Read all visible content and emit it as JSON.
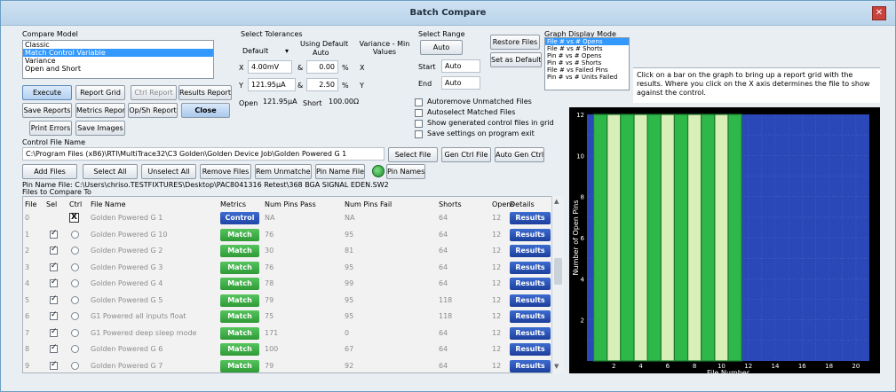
{
  "window": {
    "title": "Batch Compare"
  },
  "compare_model": {
    "label": "Compare Model",
    "options": [
      "Classic",
      "Match Control Variable",
      "Variance",
      "Open and Short"
    ],
    "selected": "Match Control Variable"
  },
  "tolerances": {
    "label": "Select Tolerances",
    "preset": "Default",
    "using_default": "Using Default",
    "auto": "Auto",
    "variance_min": "Variance - Min Values",
    "x_label": "X",
    "x_value": "4.00mV",
    "x_pct": "0.00",
    "x_unit": "X",
    "y_label": "Y",
    "y_value": "121.95µA",
    "y_pct": "2.50",
    "y_unit": "Y",
    "amp": "&",
    "pct_sign": "%",
    "open_label": "Open",
    "open_value": "121.95µA",
    "short_label": "Short",
    "short_value": "100.00Ω"
  },
  "range": {
    "label": "Select Range",
    "auto_button": "Auto",
    "start_label": "Start",
    "start_value": "Auto",
    "end_label": "End",
    "end_value": "Auto"
  },
  "buttons": {
    "execute": "Execute",
    "report_grid": "Report Grid",
    "ctrl_report": "Ctrl Report",
    "results_report": "Results Report",
    "save_reports": "Save Reports",
    "metrics_report": "Metrics Report",
    "op_sh_report": "Op/Sh Report",
    "close": "Close",
    "print_errors": "Print Errors",
    "save_images": "Save Images",
    "restore_files": "Restore Files",
    "set_as_default": "Set as Default",
    "select_file": "Select File",
    "gen_ctrl_file": "Gen Ctrl File",
    "auto_gen_ctrl": "Auto Gen Ctrl",
    "add_files": "Add Files",
    "select_all": "Select All",
    "unselect_all": "Unselect All",
    "remove_files": "Remove Files",
    "rem_unmatched": "Rem Unmatched",
    "pin_name_file": "Pin Name File",
    "pin_names": "Pin Names"
  },
  "options": [
    {
      "label": "Autoremove Unmatched Files",
      "checked": false
    },
    {
      "label": "Autoselect Matched Files",
      "checked": false
    },
    {
      "label": "Show generated control files in grid",
      "checked": false
    },
    {
      "label": "Save settings on program exit",
      "checked": false
    }
  ],
  "graph_mode": {
    "label": "Graph Display Mode",
    "options": [
      "File # vs # Opens",
      "File # vs # Shorts",
      "Pin # vs # Opens",
      "Pin # vs # Shorts",
      "File # vs Failed Pins",
      "Pin # vs # Units Failed"
    ],
    "selected": "File # vs # Opens"
  },
  "info_text": "Click on a bar on the graph to bring up a report grid with the results. Where you click on the X axis determines the file to show against the control.",
  "control_file": {
    "label": "Control File Name",
    "path": "C:\\Program Files (x86)\\RTI\\MultiTrace32\\C3 Golden\\Golden Device Job\\Golden Powered G 1"
  },
  "pin_name_file": "Pin Name File: C:\\Users\\chriso.TESTFIXTURES\\Desktop\\PAC8041316 Retest\\368 BGA SIGNAL EDEN.SW2",
  "files_label": "Files to Compare To",
  "table": {
    "headers": [
      "File",
      "Sel",
      "Ctrl",
      "File Name",
      "Metrics",
      "Num Pins Pass",
      "Num Pins Fail",
      "Shorts",
      "Opens",
      "Details"
    ],
    "rows": [
      {
        "file": "0",
        "sel": "X",
        "name": "Golden Powered G 1",
        "metrics": "Control",
        "pass": "NA",
        "fail": "NA",
        "shorts": "64",
        "opens": "12",
        "details": "Results"
      },
      {
        "file": "1",
        "sel": "check",
        "name": "Golden Powered G 10",
        "metrics": "Match",
        "pass": "76",
        "fail": "95",
        "shorts": "64",
        "opens": "12",
        "details": "Results"
      },
      {
        "file": "2",
        "sel": "check",
        "name": "Golden Powered G 2",
        "metrics": "Match",
        "pass": "30",
        "fail": "81",
        "shorts": "64",
        "opens": "12",
        "details": "Results"
      },
      {
        "file": "3",
        "sel": "check",
        "name": "Golden Powered G 3",
        "metrics": "Match",
        "pass": "76",
        "fail": "95",
        "shorts": "64",
        "opens": "12",
        "details": "Results"
      },
      {
        "file": "4",
        "sel": "check",
        "name": "Golden Powered G 4",
        "metrics": "Match",
        "pass": "78",
        "fail": "99",
        "shorts": "64",
        "opens": "12",
        "details": "Results"
      },
      {
        "file": "5",
        "sel": "check",
        "name": "Golden Powered G 5",
        "metrics": "Match",
        "pass": "79",
        "fail": "95",
        "shorts": "118",
        "opens": "12",
        "details": "Results"
      },
      {
        "file": "6",
        "sel": "check",
        "name": "G1 Powered all inputs float",
        "metrics": "Match",
        "pass": "75",
        "fail": "95",
        "shorts": "118",
        "opens": "12",
        "details": "Results"
      },
      {
        "file": "7",
        "sel": "check",
        "name": "G1 Powered deep sleep mode",
        "metrics": "Match",
        "pass": "171",
        "fail": "0",
        "shorts": "64",
        "opens": "12",
        "details": "Results"
      },
      {
        "file": "8",
        "sel": "check",
        "name": "Golden Powered G 6",
        "metrics": "Match",
        "pass": "100",
        "fail": "67",
        "shorts": "64",
        "opens": "12",
        "details": "Results"
      },
      {
        "file": "9",
        "sel": "check",
        "name": "Golden Powered G 7",
        "metrics": "Match",
        "pass": "79",
        "fail": "92",
        "shorts": "64",
        "opens": "12",
        "details": "Results"
      }
    ]
  },
  "colors": {
    "bar_dark": "#2fb84a",
    "bar_light": "#d9efb8",
    "plot_bg": "#2a48b8",
    "plot_grid": "#4f6ad0"
  },
  "chart_data": {
    "type": "bar",
    "xlabel": "File Number",
    "ylabel": "Number of Open Pins",
    "xlim": [
      0,
      21
    ],
    "ylim": [
      0,
      12
    ],
    "x_ticks": [
      2,
      4,
      6,
      8,
      10,
      12,
      14,
      16,
      18,
      20
    ],
    "y_ticks": [
      2,
      4,
      6,
      8,
      10,
      12
    ],
    "x": [
      1,
      2,
      3,
      4,
      5,
      6,
      7,
      8,
      9,
      10,
      11
    ],
    "values": [
      12,
      12,
      12,
      12,
      12,
      12,
      12,
      12,
      12,
      12,
      12
    ]
  }
}
